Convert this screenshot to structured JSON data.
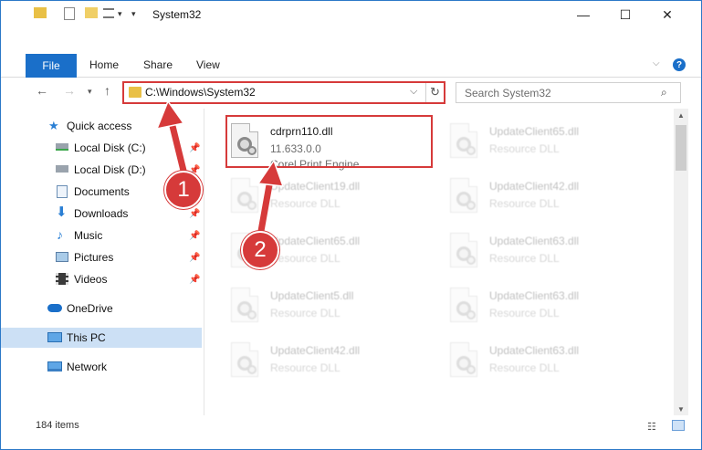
{
  "window": {
    "title": "System32",
    "minimize_glyph": "—",
    "maximize_glyph": "☐",
    "close_glyph": "✕"
  },
  "ribbon": {
    "file_tab": "File",
    "tabs": [
      "Home",
      "Share",
      "View"
    ]
  },
  "navbar": {
    "address_path": "C:\\Windows\\System32",
    "search_placeholder": "Search System32"
  },
  "sidebar": {
    "items": [
      {
        "label": "Quick access",
        "icon": "star-icon",
        "pinned": false
      },
      {
        "label": "Local Disk (C:)",
        "icon": "drive-icon",
        "pinned": true
      },
      {
        "label": "Local Disk (D:)",
        "icon": "drive-icon",
        "pinned": true
      },
      {
        "label": "Documents",
        "icon": "documents-icon",
        "pinned": true
      },
      {
        "label": "Downloads",
        "icon": "download-icon",
        "pinned": true
      },
      {
        "label": "Music",
        "icon": "music-icon",
        "pinned": true
      },
      {
        "label": "Pictures",
        "icon": "pictures-icon",
        "pinned": true
      },
      {
        "label": "Videos",
        "icon": "videos-icon",
        "pinned": true
      },
      {
        "label": "OneDrive",
        "icon": "cloud-icon",
        "pinned": false
      },
      {
        "label": "This PC",
        "icon": "computer-icon",
        "pinned": false,
        "selected": true
      },
      {
        "label": "Network",
        "icon": "network-icon",
        "pinned": false
      }
    ]
  },
  "files": [
    {
      "name": "cdrprn110.dll",
      "line2": "11.633.0.0",
      "line3": "Corel Print Engine",
      "highlighted": true
    },
    {
      "name": "UpdateClient65.dll",
      "line2": "Resource DLL"
    },
    {
      "name": "UpdateClient19.dll",
      "line2": "Resource DLL"
    },
    {
      "name": "UpdateClient42.dll",
      "line2": "Resource DLL"
    },
    {
      "name": "UpdateClient65.dll",
      "line2": "Resource DLL"
    },
    {
      "name": "UpdateClient63.dll",
      "line2": "Resource DLL"
    },
    {
      "name": "UpdateClient5.dll",
      "line2": "Resource DLL"
    },
    {
      "name": "UpdateClient63.dll",
      "line2": "Resource DLL"
    },
    {
      "name": "UpdateClient42.dll",
      "line2": "Resource DLL"
    },
    {
      "name": "UpdateClient63.dll",
      "line2": "Resource DLL"
    }
  ],
  "status": {
    "item_count": "184 items"
  },
  "callouts": {
    "one": "1",
    "two": "2"
  },
  "colors": {
    "accent": "#1a6fc9",
    "annotation_red": "#d63a3a",
    "selection": "#cce0f5"
  }
}
